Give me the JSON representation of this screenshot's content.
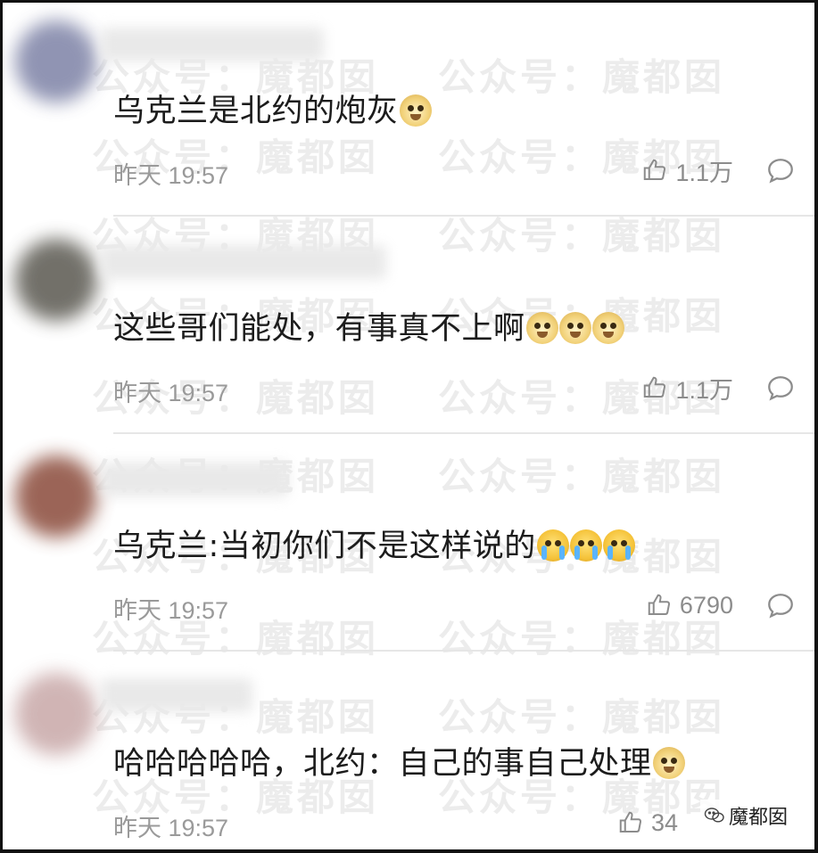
{
  "watermark_text": "公众号：魔都囡",
  "brand": {
    "text": "魔都囡",
    "icon": "wechat-icon"
  },
  "comments": [
    {
      "text": "乌克兰是北约的炮灰",
      "emojis": [
        "doge"
      ],
      "time": "昨天 19:57",
      "likes": "1.1万",
      "avatar_color": "#7d82a6"
    },
    {
      "text": "这些哥们能处，有事真不上啊",
      "emojis": [
        "doge",
        "doge",
        "doge"
      ],
      "time": "昨天 19:57",
      "likes": "1.1万",
      "avatar_color": "#5a5850"
    },
    {
      "text": "乌克兰:当初你们不是这样说的",
      "emojis": [
        "cry",
        "cry",
        "cry"
      ],
      "time": "昨天 19:57",
      "likes": "6790",
      "avatar_color": "#8a4a3a"
    },
    {
      "text": "哈哈哈哈哈，北约：自己的事自己处理",
      "emojis": [
        "doge"
      ],
      "time": "昨天 19:57",
      "likes": "34",
      "avatar_color": "#c8a8a8"
    }
  ]
}
